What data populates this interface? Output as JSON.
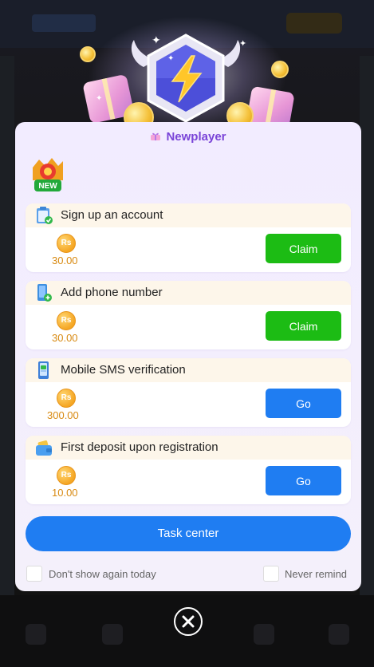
{
  "modal": {
    "title": "Newplayer",
    "tasks": [
      {
        "title": "Sign up an account",
        "currency": "Rs",
        "amount": "30.00",
        "button": "Claim",
        "button_type": "claim",
        "icon": "clipboard-check-icon"
      },
      {
        "title": "Add phone number",
        "currency": "Rs",
        "amount": "30.00",
        "button": "Claim",
        "button_type": "claim",
        "icon": "phone-add-icon"
      },
      {
        "title": "Mobile SMS verification",
        "currency": "Rs",
        "amount": "300.00",
        "button": "Go",
        "button_type": "go",
        "icon": "phone-verify-icon"
      },
      {
        "title": "First deposit upon registration",
        "currency": "Rs",
        "amount": "10.00",
        "button": "Go",
        "button_type": "go",
        "icon": "wallet-icon"
      }
    ],
    "task_center_label": "Task center",
    "dont_show_label": "Don't show again today",
    "never_remind_label": "Never remind",
    "new_badge": "NEW"
  },
  "colors": {
    "title": "#7a44d8",
    "claim": "#1cbc14",
    "go": "#1f7df2",
    "amount": "#d88a12"
  }
}
